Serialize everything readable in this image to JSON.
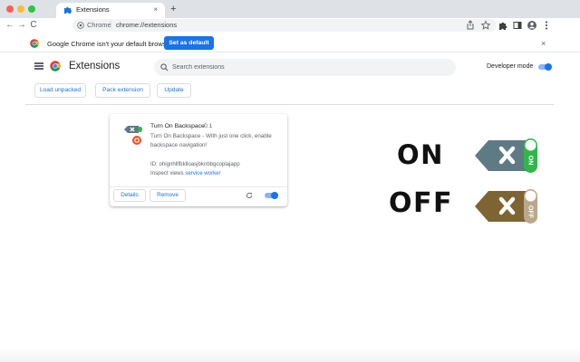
{
  "tab": {
    "title": "Extensions",
    "close": "×",
    "new_tab": "+"
  },
  "toolbar": {
    "back": "←",
    "forward": "→",
    "reload": "C",
    "site": "Chrome",
    "separator": "|",
    "url": "chrome://extensions"
  },
  "infobar": {
    "message": "Google Chrome isn't your default browser",
    "button": "Set as default",
    "close": "×"
  },
  "header": {
    "title": "Extensions",
    "search_placeholder": "Search extensions",
    "developer_mode_label": "Developer mode",
    "developer_mode_on": true,
    "buttons": {
      "load_unpacked": "Load unpacked",
      "pack_extension": "Pack extension",
      "update": "Update"
    }
  },
  "extension": {
    "name": "Turn On Backspace",
    "version": "0.1",
    "description": "Turn On Backspace - With just one click, enable backspace navigation!",
    "id": "ID: ohignhllfbklloasjbknbbgcoplajapp",
    "inspect_label": "Inspect views",
    "inspect_link": "service worker",
    "details": "Details",
    "remove": "Remove",
    "enabled": true
  },
  "promo": {
    "on_label": "ON",
    "off_label": "OFF",
    "on_switch_text": "ON",
    "off_switch_text": "OFF",
    "on_color": "#5e7a84",
    "off_color": "#7e6433"
  },
  "colors": {
    "accent": "#1a73e8",
    "tabstrip": "#dee1e6",
    "switch_on": "#30b64a",
    "switch_off": "#b9a88a"
  }
}
